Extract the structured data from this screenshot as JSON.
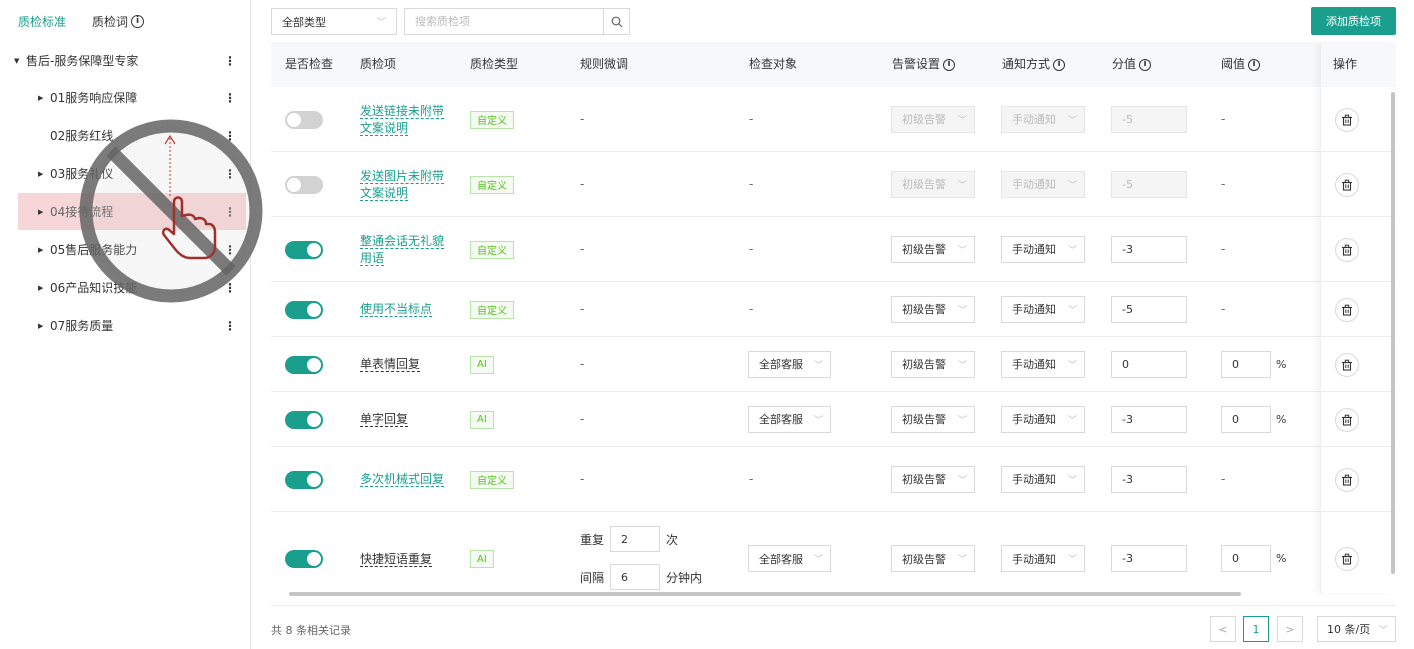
{
  "sidebar": {
    "tabs": [
      {
        "label": "质检标准",
        "active": true
      },
      {
        "label": "质检词",
        "active": false
      }
    ],
    "root": {
      "label": "售后-服务保障型专家"
    },
    "items": [
      {
        "label": "01服务响应保障",
        "caret": true
      },
      {
        "label": "02服务红线",
        "caret": false
      },
      {
        "label": "03服务礼仪",
        "caret": true
      },
      {
        "label": "04接待流程",
        "caret": true,
        "selected": true
      },
      {
        "label": "05售后服务能力",
        "caret": true
      },
      {
        "label": "06产品知识技能",
        "caret": true
      },
      {
        "label": "07服务质量",
        "caret": true
      }
    ]
  },
  "toolbar": {
    "type_select": "全部类型",
    "search_placeholder": "搜索质检项",
    "add_label": "添加质检项"
  },
  "table": {
    "headers": {
      "check": "是否检查",
      "item": "质检项",
      "type": "质检类型",
      "rule": "规则微调",
      "target": "检查对象",
      "alarm": "告警设置",
      "notify": "通知方式",
      "score": "分值",
      "threshold": "阈值",
      "ops": "操作"
    },
    "rows": [
      {
        "on": false,
        "name": "发送链接未附带文案说明",
        "name_link": true,
        "type": "自定义",
        "rule": "-",
        "target": "-",
        "target_dd": false,
        "alarm": "初级告警",
        "notify": "手动通知",
        "score": "-5",
        "disabled": true,
        "threshold": "-",
        "threshold_input": false
      },
      {
        "on": false,
        "name": "发送图片未附带文案说明",
        "name_link": true,
        "type": "自定义",
        "rule": "-",
        "target": "-",
        "target_dd": false,
        "alarm": "初级告警",
        "notify": "手动通知",
        "score": "-5",
        "disabled": true,
        "threshold": "-",
        "threshold_input": false
      },
      {
        "on": true,
        "name": "整通会话无礼貌用语",
        "name_link": true,
        "type": "自定义",
        "rule": "-",
        "target": "-",
        "target_dd": false,
        "alarm": "初级告警",
        "notify": "手动通知",
        "score": "-3",
        "disabled": false,
        "threshold": "-",
        "threshold_input": false
      },
      {
        "on": true,
        "name": "使用不当标点",
        "name_link": true,
        "type": "自定义",
        "rule": "-",
        "target": "-",
        "target_dd": false,
        "alarm": "初级告警",
        "notify": "手动通知",
        "score": "-5",
        "disabled": false,
        "threshold": "-",
        "threshold_input": false
      },
      {
        "on": true,
        "name": "单表情回复",
        "name_link": false,
        "type": "AI",
        "rule": "-",
        "target": "全部客服",
        "target_dd": true,
        "alarm": "初级告警",
        "notify": "手动通知",
        "score": "0",
        "disabled": false,
        "threshold": "0",
        "threshold_input": true
      },
      {
        "on": true,
        "name": "单字回复",
        "name_link": false,
        "type": "AI",
        "rule": "-",
        "target": "全部客服",
        "target_dd": true,
        "alarm": "初级告警",
        "notify": "手动通知",
        "score": "-3",
        "disabled": false,
        "threshold": "0",
        "threshold_input": true
      },
      {
        "on": true,
        "name": "多次机械式回复",
        "name_link": true,
        "type": "自定义",
        "rule": "-",
        "target": "-",
        "target_dd": false,
        "alarm": "初级告警",
        "notify": "手动通知",
        "score": "-3",
        "disabled": false,
        "threshold": "-",
        "threshold_input": false
      },
      {
        "on": true,
        "name": "快捷短语重复",
        "name_link": false,
        "type": "AI",
        "rule": "custom",
        "target": "全部客服",
        "target_dd": true,
        "alarm": "初级告警",
        "notify": "手动通知",
        "score": "-3",
        "disabled": false,
        "threshold": "0",
        "threshold_input": true
      }
    ],
    "percent": "%",
    "rule_custom": {
      "repeat_label": "重复",
      "repeat_value": "2",
      "repeat_unit": "次",
      "interval_label": "间隔",
      "interval_value": "6",
      "interval_unit": "分钟内"
    }
  },
  "footer": {
    "total": "共 8 条相关记录",
    "prev": "<",
    "page": "1",
    "next": ">",
    "page_size": "10 条/页"
  },
  "colors": {
    "accent": "#1a9f8f",
    "selected_row": "#f7d6d9",
    "tag_green": "#52c41a"
  }
}
